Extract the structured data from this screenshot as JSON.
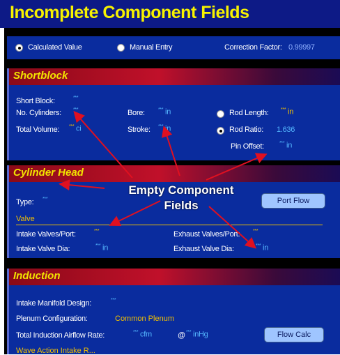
{
  "title": "Incomplete Component Fields",
  "top": {
    "calculated_value": "Calculated Value",
    "manual_entry": "Manual Entry",
    "correction_factor_label": "Correction Factor:",
    "correction_factor_value": "0.99997"
  },
  "shortblock": {
    "header": "Shortblock",
    "short_block_label": "Short Block:",
    "short_block_value": "***",
    "cylinders_label": "No. Cylinders:",
    "cylinders_value": "***",
    "total_volume_label": "Total Volume:",
    "total_volume_value": "***",
    "total_volume_unit": "ci",
    "bore_label": "Bore:",
    "bore_value": "***",
    "bore_unit": "in",
    "stroke_label": "Stroke:",
    "stroke_value": "***",
    "stroke_unit": "in",
    "rod_length_label": "Rod Length:",
    "rod_length_value": "***",
    "rod_length_unit": "in",
    "rod_ratio_label": "Rod Ratio:",
    "rod_ratio_value": "1.636",
    "pin_offset_label": "Pin Offset:",
    "pin_offset_value": "***",
    "pin_offset_unit": "in"
  },
  "cylinder_head": {
    "header": "Cylinder Head",
    "type_label": "Type:",
    "type_value": "***",
    "port_flow_button": "Port Flow",
    "valve_label": "Valve",
    "intake_valves_label": "Intake Valves/Port:",
    "intake_valves_value": "***",
    "exhaust_valves_label": "Exhaust Valves/Port:",
    "exhaust_valves_value": "***",
    "intake_dia_label": "Intake Valve Dia:",
    "intake_dia_value": "***",
    "intake_dia_unit": "in",
    "exhaust_dia_label": "Exhaust Valve Dia:",
    "exhaust_dia_value": "***",
    "exhaust_dia_unit": "in"
  },
  "induction": {
    "header": "Induction",
    "manifold_label": "Intake Manifold Design:",
    "manifold_value": "***",
    "plenum_label": "Plenum Configuration:",
    "plenum_value": "Common Plenum",
    "airflow_label": "Total Induction Airflow Rate:",
    "airflow_value": "***",
    "airflow_unit": "cfm",
    "at_symbol": "@",
    "hg_value": "***",
    "hg_unit": "inHg",
    "flow_calc_button": "Flow Calc",
    "partial_text": "Wave Action Intake R..."
  },
  "annotation": {
    "line1": "Empty Component",
    "line2": "Fields"
  },
  "colors": {
    "title_bg": "#0d1a86",
    "title_text": "#f7f200",
    "panel_bg": "#0a2c9e",
    "value_blue": "#55b8ff",
    "header_yellow": "#f2e400",
    "arrow_red": "#e01020"
  }
}
